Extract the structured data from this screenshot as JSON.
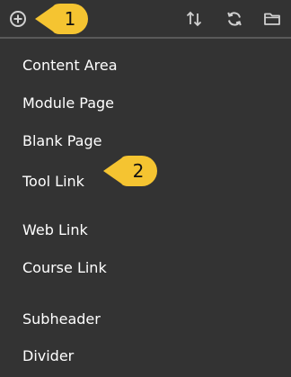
{
  "toolbar": {
    "icons": [
      "add-circle-icon",
      "sort-arrows-icon",
      "refresh-icon",
      "folder-icon"
    ]
  },
  "callouts": [
    {
      "number": "1"
    },
    {
      "number": "2"
    }
  ],
  "menu": {
    "items": [
      {
        "label": "Content Area"
      },
      {
        "label": "Module Page"
      },
      {
        "label": "Blank Page"
      },
      {
        "label": "Tool Link"
      },
      {
        "label": "Web Link"
      },
      {
        "label": "Course Link"
      },
      {
        "label": "Subheader"
      },
      {
        "label": "Divider"
      }
    ]
  },
  "colors": {
    "background": "#333333",
    "text": "#ffffff",
    "icon": "#d0d0d0",
    "callout": "#f5c431",
    "divider": "#5a5a5a"
  }
}
